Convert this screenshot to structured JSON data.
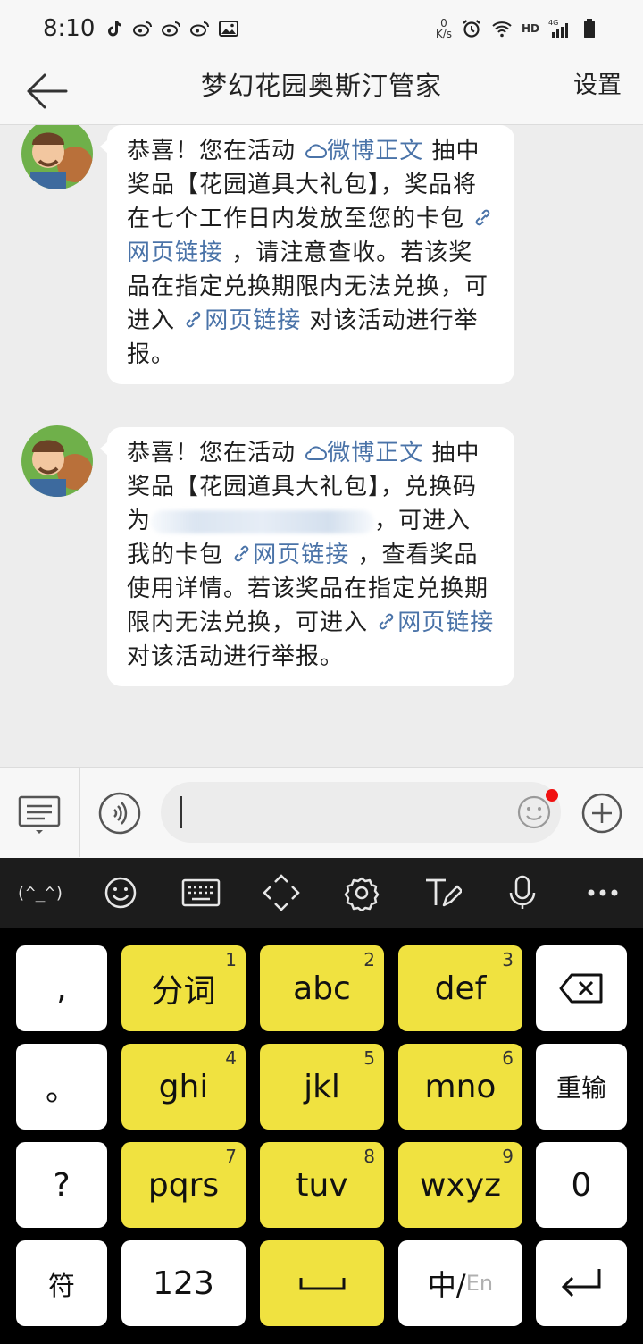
{
  "status_bar": {
    "time": "8:10",
    "net_speed_value": "0",
    "net_speed_unit": "K/s",
    "network_type": "HD",
    "signal_label": "4G"
  },
  "header": {
    "title": "梦幻花园奥斯汀管家",
    "settings_label": "设置"
  },
  "messages": [
    {
      "sender": "梦幻花园奥斯汀管家",
      "segments": [
        {
          "text": "恭喜！您在活动 ",
          "type": "text"
        },
        {
          "text": "微博正文",
          "type": "link",
          "icon": "weibo-cloud-icon"
        },
        {
          "text": " 抽中奖品【花园道具大礼包】，奖品将在七个工作日内发放至您的卡包 ",
          "type": "text"
        },
        {
          "text": "网页链接",
          "type": "link",
          "icon": "link-icon"
        },
        {
          "text": " ，请注意查收。若该奖品在指定兑换期限内无法兑换，可进入 ",
          "type": "text"
        },
        {
          "text": "网页链接",
          "type": "link",
          "icon": "link-icon"
        },
        {
          "text": " 对该活动进行举报。",
          "type": "text"
        }
      ]
    },
    {
      "sender": "梦幻花园奥斯汀管家",
      "segments": [
        {
          "text": "恭喜！您在活动 ",
          "type": "text"
        },
        {
          "text": "微博正文",
          "type": "link",
          "icon": "weibo-cloud-icon"
        },
        {
          "text": " 抽中奖品【花园道具大礼包】，兑换码为",
          "type": "text"
        },
        {
          "text": "",
          "type": "redacted"
        },
        {
          "text": "，可进入我的卡包 ",
          "type": "text"
        },
        {
          "text": "网页链接",
          "type": "link",
          "icon": "link-icon"
        },
        {
          "text": " ，查看奖品使用详情。若该奖品在指定兑换期限内无法兑换，可进入 ",
          "type": "text"
        },
        {
          "text": "网页链接",
          "type": "link",
          "icon": "link-icon"
        },
        {
          "text": " 对该活动进行举报。",
          "type": "text"
        }
      ]
    }
  ],
  "input_bar": {
    "value": "",
    "placeholder": ""
  },
  "ime_toolbar": {
    "kaomoji_label": "(^_^)",
    "tools": [
      "kaomoji",
      "emoji-icon",
      "keyboard-icon",
      "cursor-move-icon",
      "gear-icon",
      "handwriting-icon",
      "microphone-icon",
      "more-icon"
    ]
  },
  "keyboard": {
    "keys": [
      {
        "label": ",",
        "num": "",
        "color": "white",
        "name": "key-comma"
      },
      {
        "label": "分词",
        "num": "1",
        "color": "yellow",
        "name": "key-1-segment"
      },
      {
        "label": "abc",
        "num": "2",
        "color": "yellow",
        "name": "key-2-abc"
      },
      {
        "label": "def",
        "num": "3",
        "color": "yellow",
        "name": "key-3-def"
      },
      {
        "label": "",
        "num": "",
        "color": "white",
        "name": "key-backspace"
      },
      {
        "label": "。",
        "num": "",
        "color": "white",
        "name": "key-period"
      },
      {
        "label": "ghi",
        "num": "4",
        "color": "yellow",
        "name": "key-4-ghi"
      },
      {
        "label": "jkl",
        "num": "5",
        "color": "yellow",
        "name": "key-5-jkl"
      },
      {
        "label": "mno",
        "num": "6",
        "color": "yellow",
        "name": "key-6-mno"
      },
      {
        "label": "重输",
        "num": "",
        "color": "white",
        "name": "key-reenter"
      },
      {
        "label": "?",
        "num": "",
        "color": "white",
        "name": "key-question"
      },
      {
        "label": "pqrs",
        "num": "7",
        "color": "yellow",
        "name": "key-7-pqrs"
      },
      {
        "label": "tuv",
        "num": "8",
        "color": "yellow",
        "name": "key-8-tuv"
      },
      {
        "label": "wxyz",
        "num": "9",
        "color": "yellow",
        "name": "key-9-wxyz"
      },
      {
        "label": "0",
        "num": "",
        "color": "white",
        "name": "key-0"
      },
      {
        "label": "符",
        "num": "",
        "color": "white",
        "name": "key-symbols"
      },
      {
        "label": "123",
        "num": "",
        "color": "white",
        "name": "key-numbers"
      },
      {
        "label": "",
        "num": "",
        "color": "yellow",
        "name": "key-space"
      },
      {
        "label": "中/",
        "num": "",
        "color": "white",
        "name": "key-lang-switch",
        "suffix": "En"
      },
      {
        "label": "",
        "num": "",
        "color": "white",
        "name": "key-enter"
      }
    ]
  },
  "colors": {
    "link": "#4a73a8",
    "key_yellow": "#f0e240",
    "keyboard_bg": "#000000",
    "toolbar_bg": "#1c1c1c",
    "chat_bg": "#ededed",
    "notification_dot": "#f01010"
  }
}
